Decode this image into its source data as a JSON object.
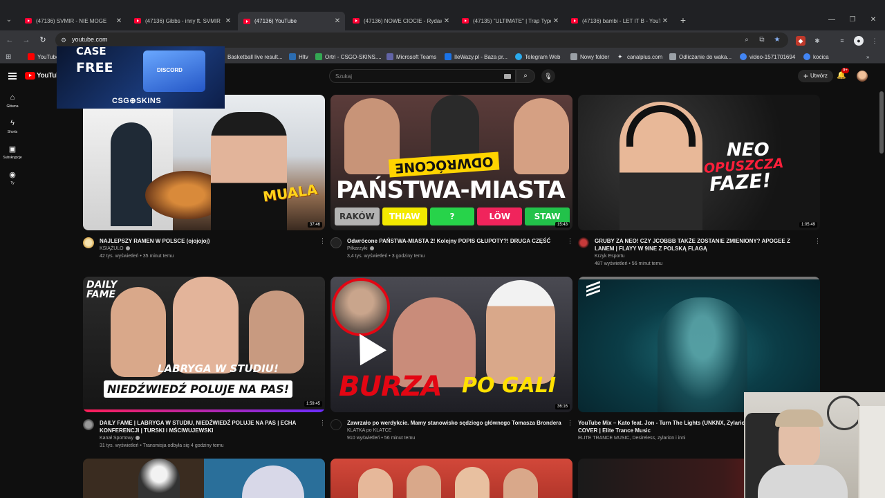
{
  "browser": {
    "tabs": [
      {
        "label": "(47136) SVMIR - NIE MOGE",
        "active": false
      },
      {
        "label": "(47136) Gibbs - inny ft. SVMIR",
        "active": false
      },
      {
        "label": "(47136) YouTube",
        "active": true
      },
      {
        "label": "(47136) NOWE CIOCIE - Rydaw",
        "active": false
      },
      {
        "label": "(47135) \"ULTIMATE\" | Trap Type",
        "active": false
      },
      {
        "label": "(47136) bambi - LET IT B - YouT",
        "active": false
      }
    ],
    "url": "youtube.com",
    "bookmarks": [
      {
        "label": "YouTube",
        "color": "#ff0000"
      },
      {
        "label": "Basketball live result...",
        "color": "#e8710a"
      },
      {
        "label": "Hltv",
        "color": "#2b6cb0"
      },
      {
        "label": "Ortri - CSGO-SKINS....",
        "color": "#34a853"
      },
      {
        "label": "Microsoft Teams",
        "color": "#6264a7"
      },
      {
        "label": "IleWazy.pl - Baza pr...",
        "color": "#1a73e8"
      },
      {
        "label": "Telegram Web",
        "color": "#2aabee"
      },
      {
        "label": "Nowy folder",
        "color": "#9aa0a6"
      },
      {
        "label": "canalplus.com",
        "color": "#e8eaed"
      },
      {
        "label": "Odliczanie do waka...",
        "color": "#9aa0a6"
      },
      {
        "label": "video-1571701694",
        "color": "#4285f4"
      },
      {
        "label": "kocica",
        "color": "#4285f4"
      }
    ]
  },
  "youtube": {
    "logo_text": "YouTube",
    "search_placeholder": "Szukaj",
    "create_label": "Utwórz",
    "notif_count": "9+",
    "guide": [
      {
        "icon": "home-icon",
        "label": "Główna"
      },
      {
        "icon": "shorts-icon",
        "label": "Shorts"
      },
      {
        "icon": "subscriptions-icon",
        "label": "Subskrypcje"
      },
      {
        "icon": "you-icon",
        "label": "Ty"
      }
    ],
    "ad": {
      "case_text": "CASE",
      "free_text": "FREE",
      "box_text": "DISCORD",
      "brand": "CSG⊕SKINS"
    },
    "videos": [
      {
        "title": "NAJLEPSZY RAMEN W POLSCE (ojojojoj)",
        "channel": "KSIĄŻULO",
        "stats": "42 tys. wyświetleń • 35 minut temu",
        "duration": "37:46",
        "thumb_text": "MUALA"
      },
      {
        "title": "Odwrócone PAŃSTWA-MIASTA 2! Kolejny POPIS GŁUPOTY?! DRUGA CZĘŚĆ",
        "channel": "Piłkarzyki",
        "stats": "3,4 tys. wyświetleń • 3 godziny temu",
        "duration": "15:43",
        "thumb_text": "PAŃSTWA-MIASTA",
        "thumb_sub": "ODWRÓCONE",
        "cells": [
          "RAKÓW",
          "THIAW",
          "?",
          "LÖW",
          "STAW"
        ]
      },
      {
        "title": "GRUBY ZA NEO! CZY JCOBBB TAKŻE ZOSTANIE ZMIENIONY? APOGEE Z LANEM | FLAYY W 9INE Z POLSKĄ FLAGĄ",
        "channel": "Krzyk Esportu",
        "stats": "487 wyświetleń • 56 minut temu",
        "duration": "1:05:49",
        "thumb_text": "NEO",
        "thumb_sub": "OPUSZCZA",
        "thumb_sub2": "FAZE!"
      },
      {
        "title": "DAILY FAME | LABRYGA W STUDIU, NIEDŹWIEDŹ POLUJE NA PAS | ECHA KONFERENCJI | TURSKI I MŚCIWUJEWSKI",
        "channel": "Kanał Sportowy",
        "stats": "31 tys. wyświetleń • Transmisja odbyła się 4 godziny temu",
        "duration": "1:59:45",
        "thumb_text": "LABRYGA W STUDIU!",
        "thumb_sub": "NIEDŹWIEDŹ POLUJE NA PAS!",
        "thumb_sub2": "DAILY FAME"
      },
      {
        "title": "Zawrzało po werdykcie. Mamy stanowisko sędziego głównego Tomasza Brondera",
        "channel": "KLATKA po KLATCE",
        "stats": "910 wyświetleń • 56 minut temu",
        "duration": "36:16",
        "thumb_text": "BURZA",
        "thumb_sub": "PO GALI"
      },
      {
        "title": "YouTube Mix – Kato feat. Jon - Turn The Lights (UNKNX, Zylarion, A",
        "title2": "COVER | Elite Trance Music",
        "channel": "ELITE TRANCE MUSIC, Desireless, zylarion i inni",
        "stats": "",
        "duration": ""
      }
    ]
  }
}
